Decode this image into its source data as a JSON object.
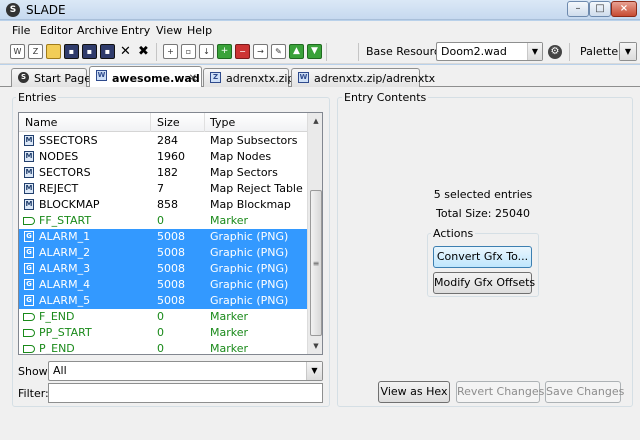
{
  "window": {
    "title": "SLADE",
    "app_icon": "slade-logo-icon"
  },
  "menu": [
    "File",
    "Editor",
    "Archive",
    "Entry",
    "View",
    "Help"
  ],
  "toolbar": {
    "base_resource_label": "Base Resource:",
    "base_resource_value": "Doom2.wad",
    "palette_label": "Palette:"
  },
  "tabs": [
    {
      "label": "Start Page",
      "icon": "slade-logo-icon",
      "active": false
    },
    {
      "label": "awesome.wad",
      "icon": "wad-file-icon",
      "active": true
    },
    {
      "label": "adrenxtx.zip",
      "icon": "zip-file-icon",
      "active": false
    },
    {
      "label": "adrenxtx.zip/adrenxtx",
      "icon": "wad-file-icon",
      "active": false
    }
  ],
  "entries_panel": {
    "title": "Entries",
    "columns": [
      "Name",
      "Size",
      "Type"
    ],
    "rows": [
      {
        "name": "SSECTORS",
        "size": "284",
        "type": "Map Subsectors",
        "kind": "map",
        "selected": false
      },
      {
        "name": "NODES",
        "size": "1960",
        "type": "Map Nodes",
        "kind": "map",
        "selected": false
      },
      {
        "name": "SECTORS",
        "size": "182",
        "type": "Map Sectors",
        "kind": "map",
        "selected": false
      },
      {
        "name": "REJECT",
        "size": "7",
        "type": "Map Reject Table",
        "kind": "map",
        "selected": false
      },
      {
        "name": "BLOCKMAP",
        "size": "858",
        "type": "Map Blockmap",
        "kind": "map",
        "selected": false
      },
      {
        "name": "FF_START",
        "size": "0",
        "type": "Marker",
        "kind": "marker",
        "selected": false
      },
      {
        "name": "ALARM_1",
        "size": "5008",
        "type": "Graphic (PNG)",
        "kind": "gfx",
        "selected": true
      },
      {
        "name": "ALARM_2",
        "size": "5008",
        "type": "Graphic (PNG)",
        "kind": "gfx",
        "selected": true
      },
      {
        "name": "ALARM_3",
        "size": "5008",
        "type": "Graphic (PNG)",
        "kind": "gfx",
        "selected": true
      },
      {
        "name": "ALARM_4",
        "size": "5008",
        "type": "Graphic (PNG)",
        "kind": "gfx",
        "selected": true
      },
      {
        "name": "ALARM_5",
        "size": "5008",
        "type": "Graphic (PNG)",
        "kind": "gfx",
        "selected": true
      },
      {
        "name": "F_END",
        "size": "0",
        "type": "Marker",
        "kind": "marker",
        "selected": false
      },
      {
        "name": "PP_START",
        "size": "0",
        "type": "Marker",
        "kind": "marker",
        "selected": false
      },
      {
        "name": "P_END",
        "size": "0",
        "type": "Marker",
        "kind": "marker",
        "selected": false
      }
    ],
    "show_label": "Show:",
    "show_value": "All",
    "filter_label": "Filter:",
    "filter_value": ""
  },
  "entry_contents": {
    "title": "Entry Contents",
    "selected_text": "5 selected entries",
    "total_size": "Total Size: 25040",
    "actions_title": "Actions",
    "convert_button": "Convert Gfx To...",
    "modify_button": "Modify Gfx Offsets",
    "view_hex_button": "View as Hex",
    "revert_button": "Revert Changes",
    "save_button": "Save Changes"
  }
}
